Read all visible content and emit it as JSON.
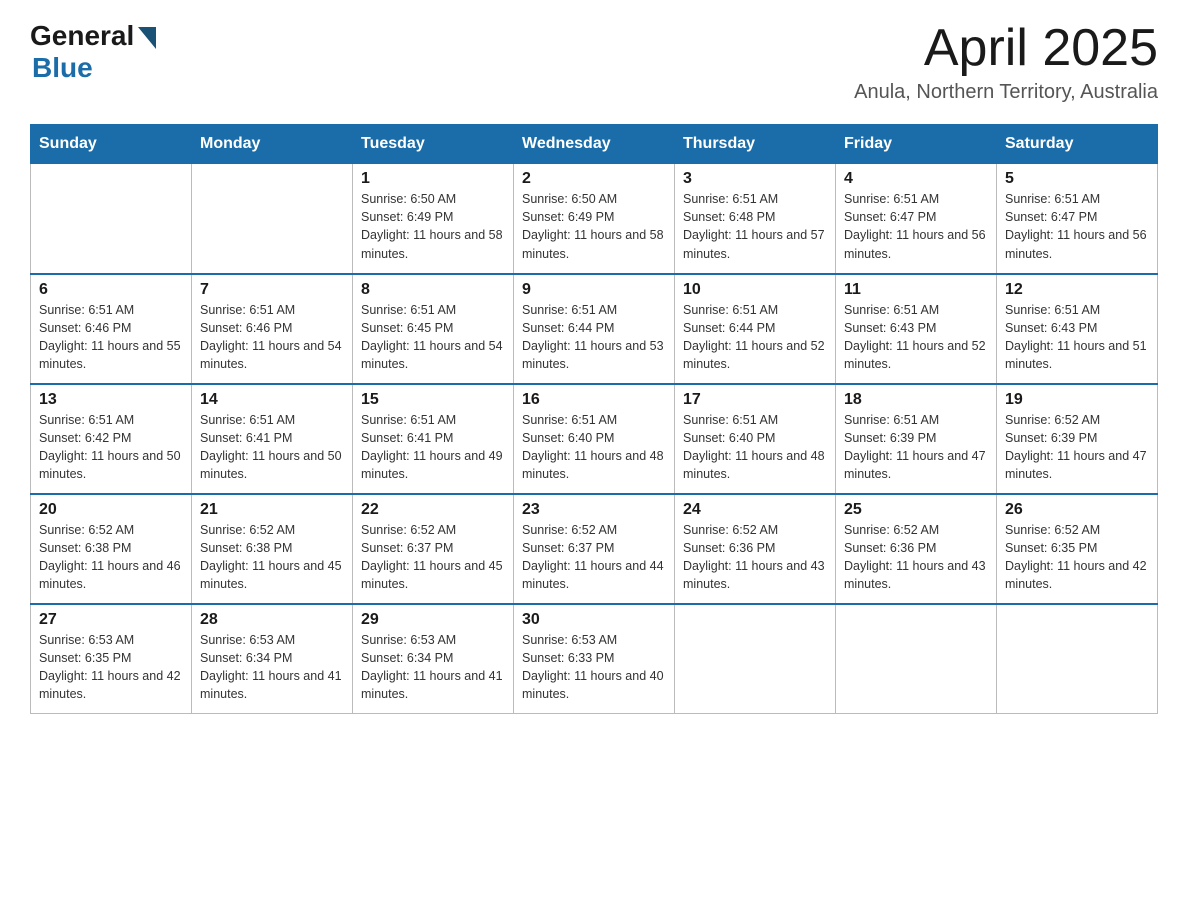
{
  "logo": {
    "general": "General",
    "blue": "Blue"
  },
  "title": "April 2025",
  "subtitle": "Anula, Northern Territory, Australia",
  "days": [
    "Sunday",
    "Monday",
    "Tuesday",
    "Wednesday",
    "Thursday",
    "Friday",
    "Saturday"
  ],
  "weeks": [
    [
      {
        "date": "",
        "sunrise": "",
        "sunset": "",
        "daylight": ""
      },
      {
        "date": "",
        "sunrise": "",
        "sunset": "",
        "daylight": ""
      },
      {
        "date": "1",
        "sunrise": "Sunrise: 6:50 AM",
        "sunset": "Sunset: 6:49 PM",
        "daylight": "Daylight: 11 hours and 58 minutes."
      },
      {
        "date": "2",
        "sunrise": "Sunrise: 6:50 AM",
        "sunset": "Sunset: 6:49 PM",
        "daylight": "Daylight: 11 hours and 58 minutes."
      },
      {
        "date": "3",
        "sunrise": "Sunrise: 6:51 AM",
        "sunset": "Sunset: 6:48 PM",
        "daylight": "Daylight: 11 hours and 57 minutes."
      },
      {
        "date": "4",
        "sunrise": "Sunrise: 6:51 AM",
        "sunset": "Sunset: 6:47 PM",
        "daylight": "Daylight: 11 hours and 56 minutes."
      },
      {
        "date": "5",
        "sunrise": "Sunrise: 6:51 AM",
        "sunset": "Sunset: 6:47 PM",
        "daylight": "Daylight: 11 hours and 56 minutes."
      }
    ],
    [
      {
        "date": "6",
        "sunrise": "Sunrise: 6:51 AM",
        "sunset": "Sunset: 6:46 PM",
        "daylight": "Daylight: 11 hours and 55 minutes."
      },
      {
        "date": "7",
        "sunrise": "Sunrise: 6:51 AM",
        "sunset": "Sunset: 6:46 PM",
        "daylight": "Daylight: 11 hours and 54 minutes."
      },
      {
        "date": "8",
        "sunrise": "Sunrise: 6:51 AM",
        "sunset": "Sunset: 6:45 PM",
        "daylight": "Daylight: 11 hours and 54 minutes."
      },
      {
        "date": "9",
        "sunrise": "Sunrise: 6:51 AM",
        "sunset": "Sunset: 6:44 PM",
        "daylight": "Daylight: 11 hours and 53 minutes."
      },
      {
        "date": "10",
        "sunrise": "Sunrise: 6:51 AM",
        "sunset": "Sunset: 6:44 PM",
        "daylight": "Daylight: 11 hours and 52 minutes."
      },
      {
        "date": "11",
        "sunrise": "Sunrise: 6:51 AM",
        "sunset": "Sunset: 6:43 PM",
        "daylight": "Daylight: 11 hours and 52 minutes."
      },
      {
        "date": "12",
        "sunrise": "Sunrise: 6:51 AM",
        "sunset": "Sunset: 6:43 PM",
        "daylight": "Daylight: 11 hours and 51 minutes."
      }
    ],
    [
      {
        "date": "13",
        "sunrise": "Sunrise: 6:51 AM",
        "sunset": "Sunset: 6:42 PM",
        "daylight": "Daylight: 11 hours and 50 minutes."
      },
      {
        "date": "14",
        "sunrise": "Sunrise: 6:51 AM",
        "sunset": "Sunset: 6:41 PM",
        "daylight": "Daylight: 11 hours and 50 minutes."
      },
      {
        "date": "15",
        "sunrise": "Sunrise: 6:51 AM",
        "sunset": "Sunset: 6:41 PM",
        "daylight": "Daylight: 11 hours and 49 minutes."
      },
      {
        "date": "16",
        "sunrise": "Sunrise: 6:51 AM",
        "sunset": "Sunset: 6:40 PM",
        "daylight": "Daylight: 11 hours and 48 minutes."
      },
      {
        "date": "17",
        "sunrise": "Sunrise: 6:51 AM",
        "sunset": "Sunset: 6:40 PM",
        "daylight": "Daylight: 11 hours and 48 minutes."
      },
      {
        "date": "18",
        "sunrise": "Sunrise: 6:51 AM",
        "sunset": "Sunset: 6:39 PM",
        "daylight": "Daylight: 11 hours and 47 minutes."
      },
      {
        "date": "19",
        "sunrise": "Sunrise: 6:52 AM",
        "sunset": "Sunset: 6:39 PM",
        "daylight": "Daylight: 11 hours and 47 minutes."
      }
    ],
    [
      {
        "date": "20",
        "sunrise": "Sunrise: 6:52 AM",
        "sunset": "Sunset: 6:38 PM",
        "daylight": "Daylight: 11 hours and 46 minutes."
      },
      {
        "date": "21",
        "sunrise": "Sunrise: 6:52 AM",
        "sunset": "Sunset: 6:38 PM",
        "daylight": "Daylight: 11 hours and 45 minutes."
      },
      {
        "date": "22",
        "sunrise": "Sunrise: 6:52 AM",
        "sunset": "Sunset: 6:37 PM",
        "daylight": "Daylight: 11 hours and 45 minutes."
      },
      {
        "date": "23",
        "sunrise": "Sunrise: 6:52 AM",
        "sunset": "Sunset: 6:37 PM",
        "daylight": "Daylight: 11 hours and 44 minutes."
      },
      {
        "date": "24",
        "sunrise": "Sunrise: 6:52 AM",
        "sunset": "Sunset: 6:36 PM",
        "daylight": "Daylight: 11 hours and 43 minutes."
      },
      {
        "date": "25",
        "sunrise": "Sunrise: 6:52 AM",
        "sunset": "Sunset: 6:36 PM",
        "daylight": "Daylight: 11 hours and 43 minutes."
      },
      {
        "date": "26",
        "sunrise": "Sunrise: 6:52 AM",
        "sunset": "Sunset: 6:35 PM",
        "daylight": "Daylight: 11 hours and 42 minutes."
      }
    ],
    [
      {
        "date": "27",
        "sunrise": "Sunrise: 6:53 AM",
        "sunset": "Sunset: 6:35 PM",
        "daylight": "Daylight: 11 hours and 42 minutes."
      },
      {
        "date": "28",
        "sunrise": "Sunrise: 6:53 AM",
        "sunset": "Sunset: 6:34 PM",
        "daylight": "Daylight: 11 hours and 41 minutes."
      },
      {
        "date": "29",
        "sunrise": "Sunrise: 6:53 AM",
        "sunset": "Sunset: 6:34 PM",
        "daylight": "Daylight: 11 hours and 41 minutes."
      },
      {
        "date": "30",
        "sunrise": "Sunrise: 6:53 AM",
        "sunset": "Sunset: 6:33 PM",
        "daylight": "Daylight: 11 hours and 40 minutes."
      },
      {
        "date": "",
        "sunrise": "",
        "sunset": "",
        "daylight": ""
      },
      {
        "date": "",
        "sunrise": "",
        "sunset": "",
        "daylight": ""
      },
      {
        "date": "",
        "sunrise": "",
        "sunset": "",
        "daylight": ""
      }
    ]
  ]
}
